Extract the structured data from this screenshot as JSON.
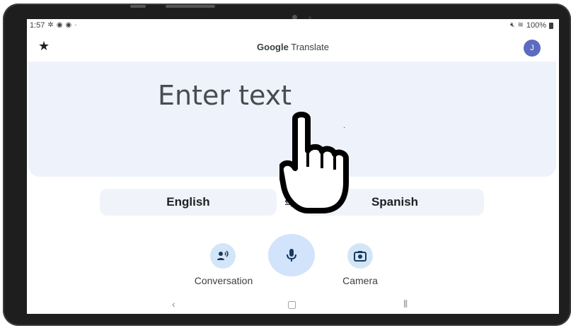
{
  "status_bar": {
    "time": "1:57",
    "battery": "100%"
  },
  "app": {
    "title_brand": "Google",
    "title_name": "Translate",
    "avatar_initial": "J"
  },
  "input": {
    "placeholder": "Enter text"
  },
  "languages": {
    "source": "English",
    "target": "Spanish"
  },
  "actions": {
    "conversation_label": "Conversation",
    "camera_label": "Camera"
  },
  "colors": {
    "text_area_bg": "#eef3fb",
    "mic_button": "#d2e3fc",
    "small_button": "#d3e6f7",
    "avatar": "#5c6bc0"
  },
  "icons": [
    "star-icon",
    "conversation-icon",
    "mic-icon",
    "camera-icon",
    "swap-icon",
    "back-nav-icon",
    "home-nav-icon",
    "recents-nav-icon",
    "pointer-hand-icon"
  ]
}
